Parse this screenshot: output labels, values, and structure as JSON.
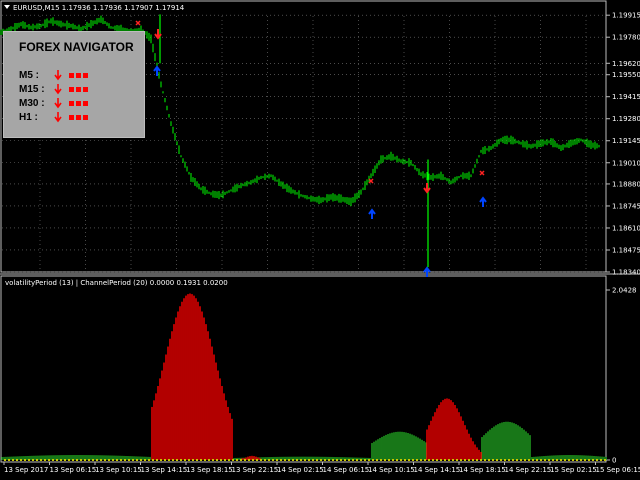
{
  "chart_header": {
    "symbol_line": "EURUSD,M15  1.17936 1.17936 1.17907 1.17914"
  },
  "navigator": {
    "title": "FOREX NAVIGATOR",
    "rows": [
      {
        "label": "M5 :",
        "direction": "down"
      },
      {
        "label": "M15 :",
        "direction": "down"
      },
      {
        "label": "M30 :",
        "direction": "down"
      },
      {
        "label": "H1 :",
        "direction": "down"
      }
    ],
    "signal_color": "#ff0000"
  },
  "subwindow": {
    "label": "volatilityPeriod (13) | ChannelPeriod (20) 0.0000 0.1931 0.0200"
  },
  "colors": {
    "background": "#000000",
    "grid": "#7a7a7a",
    "price_line": "#00ff00",
    "volatility_up": "#ff0000",
    "volatility_down": "#22aa22",
    "signal_up": "#0044ff",
    "signal_down": "#ff2222"
  },
  "chart_data": [
    {
      "type": "line",
      "name": "price",
      "ylim": [
        1.1834,
        1.1991
      ],
      "yticks": [
        "1.19915",
        "1.19780",
        "1.19620",
        "1.19550",
        "1.19415",
        "1.19280",
        "1.19145",
        "1.19010",
        "1.18880",
        "1.18745",
        "1.18610",
        "1.18475",
        "1.18340"
      ],
      "grid": true,
      "x": [
        0,
        10,
        20,
        30,
        40,
        50,
        60,
        70,
        80,
        90,
        100,
        110,
        120,
        130,
        140,
        150,
        160,
        170,
        180,
        190,
        200,
        210,
        220,
        230,
        240,
        250,
        260,
        270,
        280,
        290,
        300,
        310,
        320,
        330,
        340,
        350,
        360,
        370,
        380,
        390,
        400,
        410,
        420,
        430,
        440,
        450,
        460,
        470,
        480,
        490,
        500,
        510,
        520,
        530,
        540,
        550,
        560,
        570,
        580,
        590,
        600
      ],
      "values": [
        1.1981,
        1.1983,
        1.1986,
        1.1984,
        1.1985,
        1.1988,
        1.1986,
        1.1985,
        1.1983,
        1.1986,
        1.1989,
        1.1984,
        1.1983,
        1.1981,
        1.1983,
        1.1977,
        1.1949,
        1.1925,
        1.1905,
        1.1892,
        1.1885,
        1.1882,
        1.1881,
        1.1884,
        1.1887,
        1.1889,
        1.1892,
        1.1893,
        1.1888,
        1.1884,
        1.1881,
        1.1879,
        1.1878,
        1.188,
        1.1879,
        1.1877,
        1.1883,
        1.1893,
        1.1903,
        1.1905,
        1.1902,
        1.1901,
        1.1894,
        1.1892,
        1.1893,
        1.1889,
        1.1893,
        1.1893,
        1.1908,
        1.191,
        1.1915,
        1.1915,
        1.1913,
        1.1911,
        1.1913,
        1.1914,
        1.191,
        1.1913,
        1.1915,
        1.1912,
        1.1911
      ]
    },
    {
      "type": "bar",
      "name": "volatility",
      "ylim": [
        0,
        2.0428
      ],
      "yticks": [
        "2.0428",
        "0"
      ],
      "x": [
        "13 Sep 2017",
        "13 Sep 06:15",
        "13 Sep 10:15",
        "13 Sep 14:15",
        "13 Sep 18:15",
        "13 Sep 22:15",
        "14 Sep 02:15",
        "14 Sep 06:15",
        "14 Sep 10:15",
        "14 Sep 14:15",
        "14 Sep 18:15",
        "14 Sep 22:15",
        "15 Sep 02:15",
        "15 Sep 06:15"
      ],
      "up_segments": [
        {
          "from": 150,
          "to": 232,
          "peak": 2.0,
          "peak_at": 188
        },
        {
          "from": 425,
          "to": 480,
          "peak": 0.74,
          "peak_at": 445
        },
        {
          "from": 240,
          "to": 260,
          "peak": 0.05,
          "peak_at": 250
        }
      ],
      "down_segments": [
        {
          "from": 0,
          "to": 150,
          "level": 0.06
        },
        {
          "from": 232,
          "to": 370,
          "level": 0.04
        },
        {
          "from": 370,
          "to": 425,
          "level": 0.34
        },
        {
          "from": 480,
          "to": 530,
          "level": 0.46
        },
        {
          "from": 530,
          "to": 605,
          "level": 0.06
        }
      ]
    }
  ]
}
